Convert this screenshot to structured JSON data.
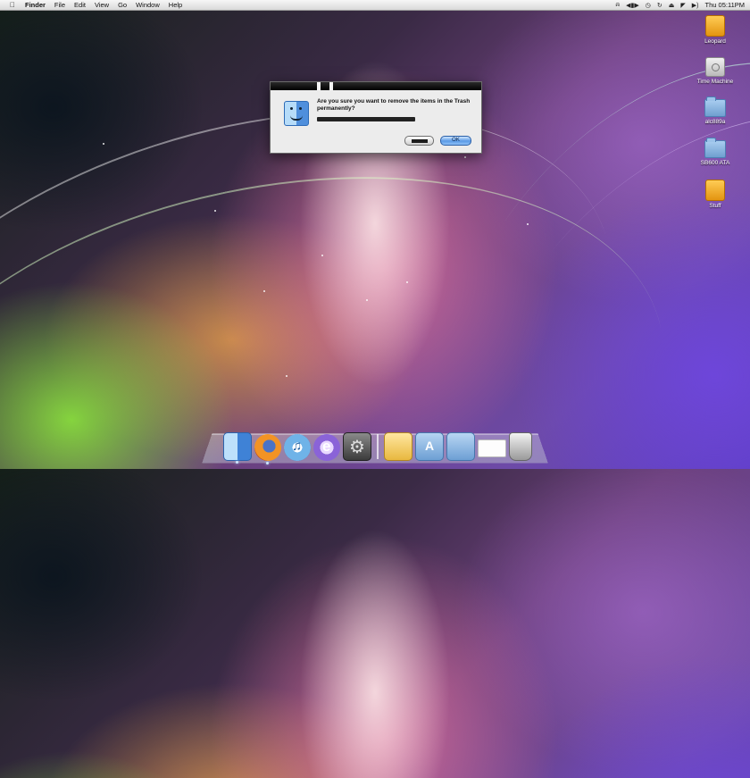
{
  "menubar": {
    "apple_icon": "apple-icon",
    "app_name": "Finder",
    "menus": [
      "File",
      "Edit",
      "View",
      "Go",
      "Window",
      "Help"
    ],
    "status_icons": [
      "headphones-icon",
      "media-controls-icon",
      "time-machine-icon",
      "sync-icon",
      "eject-icon",
      "airport-icon",
      "volume-icon"
    ],
    "clock": "Thu 05:11PM"
  },
  "desktop_icons": [
    {
      "label": "Leopard",
      "icon": "orange-drive-icon"
    },
    {
      "label": "Time Machine",
      "icon": "time-machine-drive-icon"
    },
    {
      "label": "alc889a",
      "icon": "blue-folder-icon"
    },
    {
      "label": "SB600 ATA",
      "icon": "blue-folder-icon"
    },
    {
      "label": "Stuff",
      "icon": "orange-drive-icon"
    }
  ],
  "dialog": {
    "icon": "finder-icon",
    "message": "Are you sure you want to remove the items in the Trash permanently?",
    "informative_text": "",
    "buttons": {
      "cancel": "",
      "ok": "OK"
    }
  },
  "dock": {
    "items": [
      {
        "name": "Finder",
        "icon": "finder-icon",
        "running": true
      },
      {
        "name": "Firefox",
        "icon": "firefox-icon",
        "running": true
      },
      {
        "name": "iTunes",
        "icon": "itunes-icon",
        "running": false
      },
      {
        "name": "App",
        "icon": "app-icon",
        "running": false
      },
      {
        "name": "System Preferences",
        "icon": "system-preferences-icon",
        "running": false
      },
      {
        "name": "Folder",
        "icon": "folder-icon",
        "running": false
      },
      {
        "name": "Applications",
        "icon": "applications-folder-icon",
        "running": false
      },
      {
        "name": "Documents",
        "icon": "documents-folder-icon",
        "running": false
      },
      {
        "name": "Window",
        "icon": "minimized-window-icon",
        "running": false
      },
      {
        "name": "Trash",
        "icon": "trash-icon",
        "running": false
      }
    ]
  },
  "colors": {
    "menubar": "#e6e6e6",
    "dialog_bg": "#ececec",
    "default_button": "#5a9ae6"
  }
}
